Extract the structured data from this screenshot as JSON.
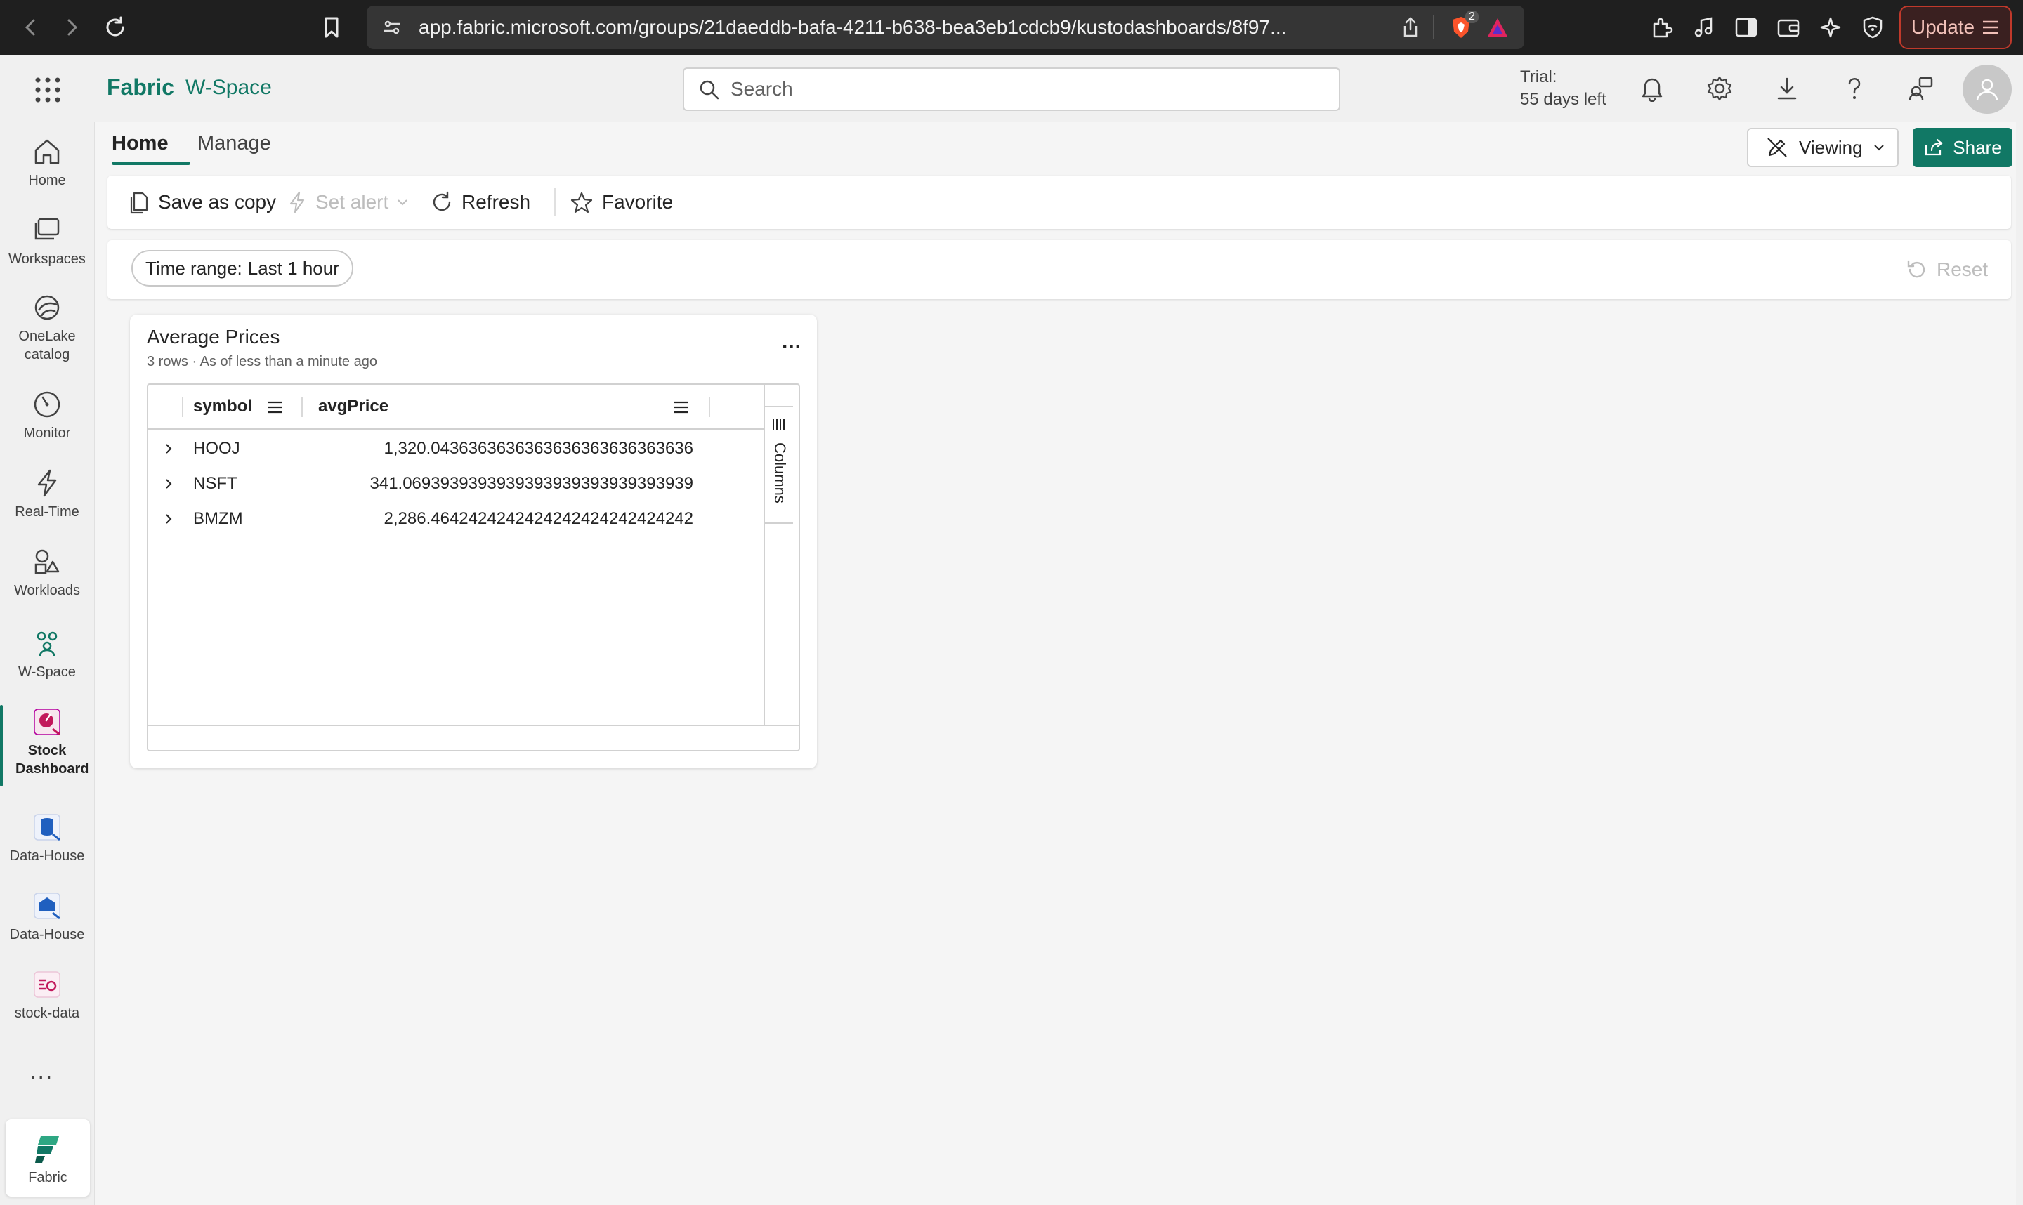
{
  "browser": {
    "url": "app.fabric.microsoft.com/groups/21daeddb-bafa-4211-b638-bea3eb1cdcb9/kustodashboards/8f97...",
    "shield_badge": "2",
    "update_label": "Update"
  },
  "header": {
    "brand": "Fabric",
    "workspace": "W-Space",
    "search_placeholder": "Search",
    "trial_line1": "Trial:",
    "trial_line2": "55 days left"
  },
  "rail": {
    "items": [
      {
        "label": "Home",
        "icon": "home-icon"
      },
      {
        "label": "Workspaces",
        "icon": "workspaces-icon"
      },
      {
        "label": "OneLake catalog",
        "icon": "onelake-icon"
      },
      {
        "label": "Monitor",
        "icon": "monitor-icon"
      },
      {
        "label": "Real-Time",
        "icon": "lightning-icon"
      },
      {
        "label": "Workloads",
        "icon": "workloads-icon"
      },
      {
        "label": "W-Space",
        "icon": "people-icon"
      },
      {
        "label": "Stock Dashboard",
        "icon": "dashboard-icon"
      },
      {
        "label": "Data-House",
        "icon": "database-icon"
      },
      {
        "label": "Data-House",
        "icon": "database-icon"
      },
      {
        "label": "stock-data",
        "icon": "eventstream-icon"
      }
    ],
    "more": "...",
    "bottom_label": "Fabric"
  },
  "tabs": [
    {
      "label": "Home"
    },
    {
      "label": "Manage"
    }
  ],
  "actions": {
    "viewing": "Viewing",
    "share": "Share"
  },
  "toolbar": {
    "save_copy": "Save as copy",
    "set_alert": "Set alert",
    "refresh": "Refresh",
    "favorite": "Favorite"
  },
  "filters": {
    "time_label": "Time range:",
    "time_value": "Last 1 hour",
    "reset": "Reset"
  },
  "tile": {
    "title": "Average Prices",
    "subtitle": "3 rows · As of less than a minute ago",
    "more": "...",
    "columns": [
      "symbol",
      "avgPrice"
    ],
    "rows": [
      {
        "symbol": "HOOJ",
        "avgPrice": "1,320.0436363636363636363636363636"
      },
      {
        "symbol": "NSFT",
        "avgPrice": "341.0693939393939393939393939393939"
      },
      {
        "symbol": "BMZM",
        "avgPrice": "2,286.4642424242424242424242424242"
      }
    ],
    "columns_panel_label": "Columns"
  },
  "colors": {
    "brand": "#117865",
    "chrome": "#1f1f1f"
  }
}
